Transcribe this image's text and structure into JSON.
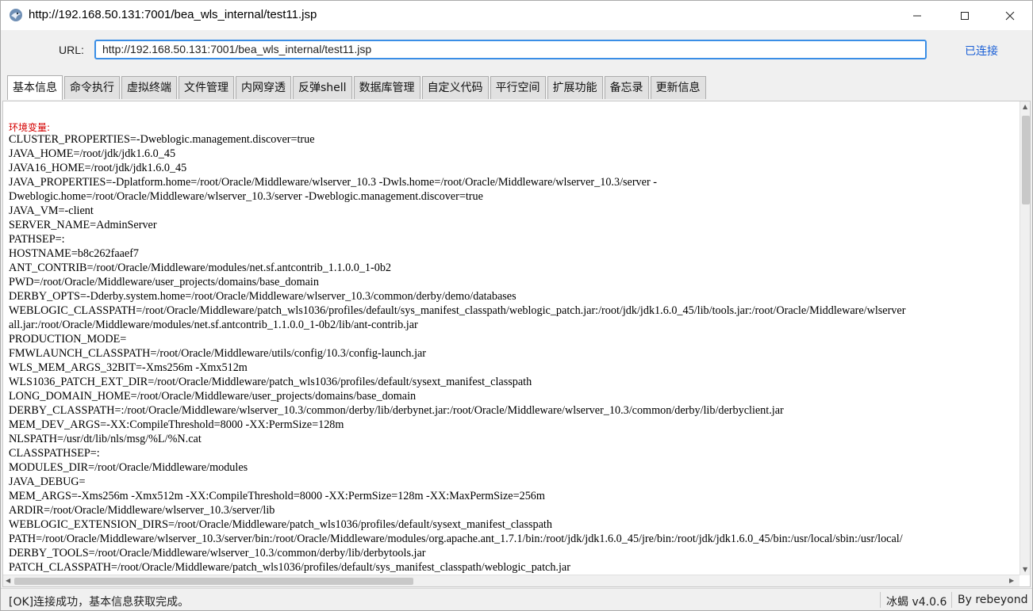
{
  "window": {
    "title": "http://192.168.50.131:7001/bea_wls_internal/test11.jsp"
  },
  "url_bar": {
    "label": "URL:",
    "value": "http://192.168.50.131:7001/bea_wls_internal/test11.jsp",
    "connection_status": "已连接"
  },
  "tabs": [
    {
      "label": "基本信息",
      "active": true
    },
    {
      "label": "命令执行"
    },
    {
      "label": "虚拟终端"
    },
    {
      "label": "文件管理"
    },
    {
      "label": "内网穿透"
    },
    {
      "label": "反弹shell"
    },
    {
      "label": "数据库管理"
    },
    {
      "label": "自定义代码"
    },
    {
      "label": "平行空间"
    },
    {
      "label": "扩展功能"
    },
    {
      "label": "备忘录"
    },
    {
      "label": "更新信息"
    }
  ],
  "content": {
    "env_label": "环境变量:",
    "lines": [
      "CLUSTER_PROPERTIES=-Dweblogic.management.discover=true",
      "JAVA_HOME=/root/jdk/jdk1.6.0_45",
      "JAVA16_HOME=/root/jdk/jdk1.6.0_45",
      "JAVA_PROPERTIES=-Dplatform.home=/root/Oracle/Middleware/wlserver_10.3 -Dwls.home=/root/Oracle/Middleware/wlserver_10.3/server -",
      "Dweblogic.home=/root/Oracle/Middleware/wlserver_10.3/server -Dweblogic.management.discover=true",
      "JAVA_VM=-client",
      "SERVER_NAME=AdminServer",
      "PATHSEP=:",
      "HOSTNAME=b8c262faaef7",
      "ANT_CONTRIB=/root/Oracle/Middleware/modules/net.sf.antcontrib_1.1.0.0_1-0b2",
      "PWD=/root/Oracle/Middleware/user_projects/domains/base_domain",
      "DERBY_OPTS=-Dderby.system.home=/root/Oracle/Middleware/wlserver_10.3/common/derby/demo/databases",
      "WEBLOGIC_CLASSPATH=/root/Oracle/Middleware/patch_wls1036/profiles/default/sys_manifest_classpath/weblogic_patch.jar:/root/jdk/jdk1.6.0_45/lib/tools.jar:/root/Oracle/Middleware/wlserver",
      "all.jar:/root/Oracle/Middleware/modules/net.sf.antcontrib_1.1.0.0_1-0b2/lib/ant-contrib.jar",
      "PRODUCTION_MODE=",
      "FMWLAUNCH_CLASSPATH=/root/Oracle/Middleware/utils/config/10.3/config-launch.jar",
      "WLS_MEM_ARGS_32BIT=-Xms256m -Xmx512m",
      "WLS1036_PATCH_EXT_DIR=/root/Oracle/Middleware/patch_wls1036/profiles/default/sysext_manifest_classpath",
      "LONG_DOMAIN_HOME=/root/Oracle/Middleware/user_projects/domains/base_domain",
      "DERBY_CLASSPATH=:/root/Oracle/Middleware/wlserver_10.3/common/derby/lib/derbynet.jar:/root/Oracle/Middleware/wlserver_10.3/common/derby/lib/derbyclient.jar",
      "MEM_DEV_ARGS=-XX:CompileThreshold=8000 -XX:PermSize=128m",
      "NLSPATH=/usr/dt/lib/nls/msg/%L/%N.cat",
      "CLASSPATHSEP=:",
      "MODULES_DIR=/root/Oracle/Middleware/modules",
      "JAVA_DEBUG=",
      "MEM_ARGS=-Xms256m -Xmx512m -XX:CompileThreshold=8000 -XX:PermSize=128m -XX:MaxPermSize=256m",
      "ARDIR=/root/Oracle/Middleware/wlserver_10.3/server/lib",
      "WEBLOGIC_EXTENSION_DIRS=/root/Oracle/Middleware/patch_wls1036/profiles/default/sysext_manifest_classpath",
      "PATH=/root/Oracle/Middleware/wlserver_10.3/server/bin:/root/Oracle/Middleware/modules/org.apache.ant_1.7.1/bin:/root/jdk/jdk1.6.0_45/jre/bin:/root/jdk/jdk1.6.0_45/bin:/usr/local/sbin:/usr/local/",
      "DERBY_TOOLS=/root/Oracle/Middleware/wlserver_10.3/common/derby/lib/derbytools.jar",
      "PATCH_CLASSPATH=/root/Oracle/Middleware/patch_wls1036/profiles/default/sys_manifest_classpath/weblogic_patch.jar"
    ]
  },
  "status_bar": {
    "message": "[OK]连接成功，基本信息获取完成。",
    "version": "冰蝎 v4.0.6",
    "author": "By rebeyond"
  },
  "colors": {
    "env_label": "#d40000",
    "url_focus_border": "#3a8ee6",
    "connected_text": "#1a5fd6"
  }
}
